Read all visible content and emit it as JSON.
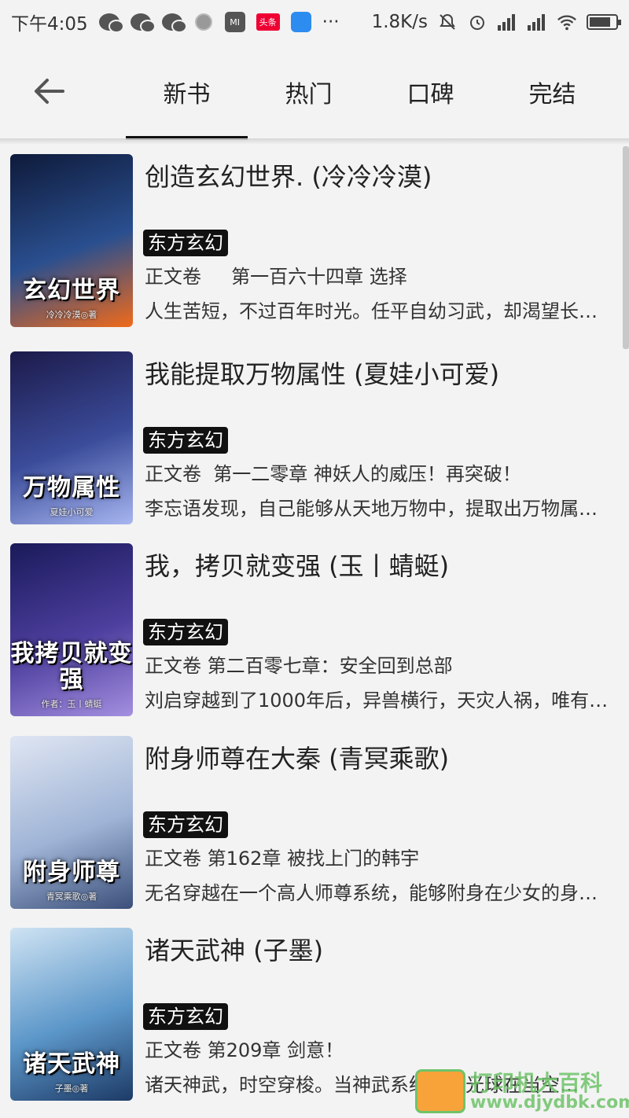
{
  "status_bar": {
    "time": "下午4:05",
    "toutiao_label": "头条",
    "mi_label": "MI",
    "more": "···",
    "net_speed": "1.8K/s"
  },
  "nav": {
    "tabs": [
      {
        "label": "新书",
        "active": true
      },
      {
        "label": "热门",
        "active": false
      },
      {
        "label": "口碑",
        "active": false
      },
      {
        "label": "完结",
        "active": false
      }
    ]
  },
  "books": [
    {
      "title": "创造玄幻世界. (冷冷冷漠)",
      "tag": "东方玄幻",
      "chapter": "正文卷     第一百六十四章 选择",
      "intro": "人生苦短，不过百年时光。任平自幼习武，却渴望长生…",
      "cover_text": "玄幻世界",
      "cover_author": "冷冷冷漠◎著",
      "cover_colors": [
        "#0e1a3a",
        "#2a4f8f",
        "#f06a1a"
      ]
    },
    {
      "title": "我能提取万物属性 (夏娃小可爱)",
      "tag": "东方玄幻",
      "chapter": "正文卷  第一二零章 神妖人的威压！再突破！",
      "intro": "李忘语发现，自己能够从天地万物中，提取出万物属性…",
      "cover_text": "万物属性",
      "cover_author": "夏娃小可爱",
      "cover_colors": [
        "#1c1a4a",
        "#3b4c9a",
        "#a7b6f0"
      ]
    },
    {
      "title": "我，拷贝就变强 (玉丨蜻蜓)",
      "tag": "东方玄幻",
      "chapter": "正文卷 第二百零七章：安全回到总部",
      "intro": "刘启穿越到了1000年后，异兽横行，天灾人祸，唯有…",
      "cover_text": "我拷贝就变强",
      "cover_author": "作者：玉丨蜻蜓",
      "cover_colors": [
        "#1a1a5a",
        "#4d3f9e",
        "#a48fe0"
      ]
    },
    {
      "title": "附身师尊在大秦 (青冥乘歌)",
      "tag": "东方玄幻",
      "chapter": "正文卷 第162章 被找上门的韩宇",
      "intro": "无名穿越在一个高人师尊系统，能够附身在少女的身上…",
      "cover_text": "附身师尊",
      "cover_author": "青冥乘歌◎著",
      "cover_colors": [
        "#dfe6f2",
        "#9fb4d6",
        "#3b4f7a"
      ]
    },
    {
      "title": "诸天武神 (子墨)",
      "tag": "东方玄幻",
      "chapter": "正文卷 第209章 剑意！",
      "intro": "诸天神武，时空穿梭。当神武系统的大光球在当空…",
      "cover_text": "诸天武神",
      "cover_author": "子墨◎著",
      "cover_colors": [
        "#cfe3f3",
        "#5c97c9",
        "#1d3a66"
      ]
    }
  ],
  "watermark": {
    "text": "打印机大百科",
    "url": "www.djydbk.com"
  }
}
